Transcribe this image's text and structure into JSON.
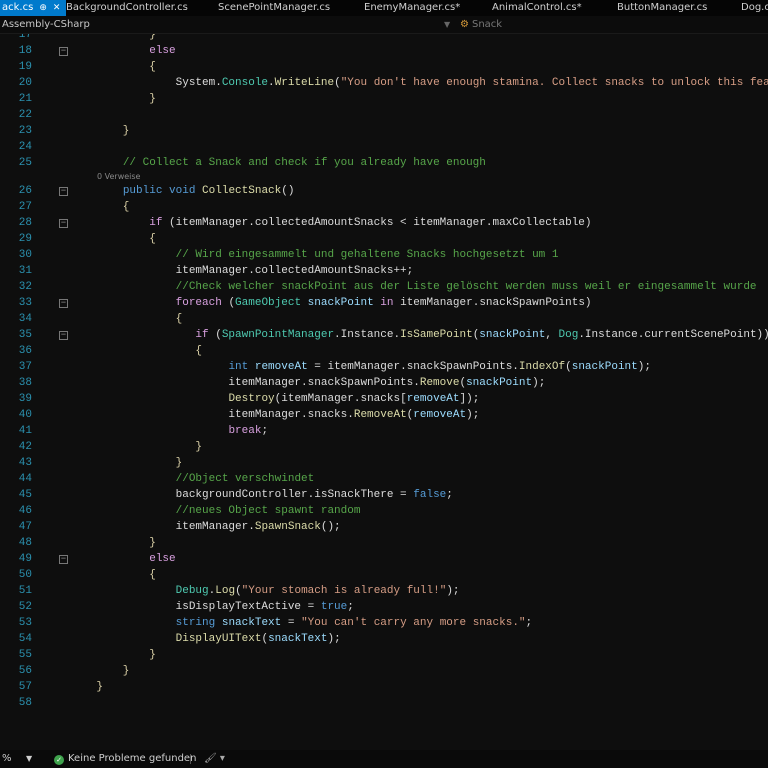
{
  "tabs": [
    {
      "label": "ack.cs",
      "active": true
    },
    {
      "label": "BackgroundController.cs"
    },
    {
      "label": "ScenePointManager.cs"
    },
    {
      "label": "EnemyManager.cs*"
    },
    {
      "label": "AnimalControl.cs*"
    },
    {
      "label": "ButtonManager.cs"
    },
    {
      "label": "Dog.c"
    }
  ],
  "navbar": {
    "project": "Assembly-CSharp",
    "member": "Snack",
    "member_icon": "class-member-icon"
  },
  "codelens": "0 Verweise",
  "lines": [
    {
      "n": "17",
      "t": [
        [
          "            }",
          "br"
        ]
      ]
    },
    {
      "n": "18",
      "fold": true,
      "t": [
        [
          "            ",
          ""
        ],
        [
          "else",
          "ctl"
        ]
      ]
    },
    {
      "n": "19",
      "t": [
        [
          "            {",
          "br"
        ]
      ]
    },
    {
      "n": "20",
      "t": [
        [
          "                System.",
          ""
        ],
        [
          "Console",
          "type"
        ],
        [
          ".",
          ""
        ],
        [
          "WriteLine",
          "method"
        ],
        [
          "(",
          ""
        ],
        [
          "\"You don't have enough stamina. Collect snacks to unlock this featu",
          "str"
        ]
      ]
    },
    {
      "n": "21",
      "t": [
        [
          "            }",
          "br"
        ]
      ]
    },
    {
      "n": "22",
      "t": []
    },
    {
      "n": "23",
      "t": [
        [
          "        }",
          "br"
        ]
      ]
    },
    {
      "n": "24",
      "t": []
    },
    {
      "n": "25",
      "t": [
        [
          "        ",
          ""
        ],
        [
          "// Collect a Snack and check if you already have enough",
          "cmt"
        ]
      ]
    },
    {
      "n": "26",
      "fold": true,
      "lens": true,
      "t": [
        [
          "        ",
          ""
        ],
        [
          "public",
          "kw"
        ],
        [
          " ",
          ""
        ],
        [
          "void",
          "kw"
        ],
        [
          " ",
          ""
        ],
        [
          "CollectSnack",
          "method"
        ],
        [
          "()",
          ""
        ]
      ]
    },
    {
      "n": "27",
      "t": [
        [
          "        {",
          "br"
        ]
      ]
    },
    {
      "n": "28",
      "fold": true,
      "t": [
        [
          "            ",
          ""
        ],
        [
          "if",
          "ctl"
        ],
        [
          " (itemManager.collectedAmountSnacks < itemManager.maxCollectable)",
          ""
        ]
      ]
    },
    {
      "n": "29",
      "t": [
        [
          "            {",
          "br"
        ]
      ]
    },
    {
      "n": "30",
      "t": [
        [
          "                ",
          ""
        ],
        [
          "// Wird eingesammelt und gehaltene Snacks hochgesetzt um 1",
          "cmt"
        ]
      ]
    },
    {
      "n": "31",
      "t": [
        [
          "                itemManager.collectedAmountSnacks++;",
          ""
        ]
      ]
    },
    {
      "n": "32",
      "t": [
        [
          "                ",
          ""
        ],
        [
          "//Check welcher snackPoint aus der Liste gelöscht werden muss weil er eingesammelt wurde",
          "cmt"
        ]
      ]
    },
    {
      "n": "33",
      "fold": true,
      "t": [
        [
          "                ",
          ""
        ],
        [
          "foreach",
          "ctl"
        ],
        [
          " (",
          ""
        ],
        [
          "GameObject",
          "type"
        ],
        [
          " ",
          ""
        ],
        [
          "snackPoint",
          "var"
        ],
        [
          " ",
          ""
        ],
        [
          "in",
          "ctl"
        ],
        [
          " itemManager.snackSpawnPoints)",
          ""
        ]
      ]
    },
    {
      "n": "34",
      "t": [
        [
          "                {",
          "br"
        ]
      ]
    },
    {
      "n": "35",
      "fold": true,
      "t": [
        [
          "                   ",
          ""
        ],
        [
          "if",
          "ctl"
        ],
        [
          " (",
          ""
        ],
        [
          "SpawnPointManager",
          "type"
        ],
        [
          ".Instance.",
          ""
        ],
        [
          "IsSamePoint",
          "method"
        ],
        [
          "(",
          ""
        ],
        [
          "snackPoint",
          "var"
        ],
        [
          ", ",
          ""
        ],
        [
          "Dog",
          "type"
        ],
        [
          ".Instance.currentScenePoint))",
          ""
        ]
      ]
    },
    {
      "n": "36",
      "t": [
        [
          "                   {",
          "br"
        ]
      ]
    },
    {
      "n": "37",
      "t": [
        [
          "                        ",
          ""
        ],
        [
          "int",
          "kw"
        ],
        [
          " ",
          ""
        ],
        [
          "removeAt",
          "var"
        ],
        [
          " = itemManager.snackSpawnPoints.",
          ""
        ],
        [
          "IndexOf",
          "method"
        ],
        [
          "(",
          ""
        ],
        [
          "snackPoint",
          "var"
        ],
        [
          ");",
          ""
        ]
      ]
    },
    {
      "n": "38",
      "t": [
        [
          "                        itemManager.snackSpawnPoints.",
          ""
        ],
        [
          "Remove",
          "method"
        ],
        [
          "(",
          ""
        ],
        [
          "snackPoint",
          "var"
        ],
        [
          ");",
          ""
        ]
      ]
    },
    {
      "n": "39",
      "t": [
        [
          "                        ",
          ""
        ],
        [
          "Destroy",
          "method"
        ],
        [
          "(itemManager.snacks[",
          ""
        ],
        [
          "removeAt",
          "var"
        ],
        [
          "]);",
          ""
        ]
      ]
    },
    {
      "n": "40",
      "t": [
        [
          "                        itemManager.snacks.",
          ""
        ],
        [
          "RemoveAt",
          "method"
        ],
        [
          "(",
          ""
        ],
        [
          "removeAt",
          "var"
        ],
        [
          ");",
          ""
        ]
      ]
    },
    {
      "n": "41",
      "t": [
        [
          "                        ",
          ""
        ],
        [
          "break",
          "ctl"
        ],
        [
          ";",
          ""
        ]
      ]
    },
    {
      "n": "42",
      "t": [
        [
          "                   }",
          "br"
        ]
      ]
    },
    {
      "n": "43",
      "t": [
        [
          "                }",
          "br"
        ]
      ]
    },
    {
      "n": "44",
      "t": [
        [
          "                ",
          ""
        ],
        [
          "//Object verschwindet",
          "cmt"
        ]
      ]
    },
    {
      "n": "45",
      "t": [
        [
          "                backgroundController.isSnackThere = ",
          ""
        ],
        [
          "false",
          "kw"
        ],
        [
          ";",
          ""
        ]
      ]
    },
    {
      "n": "46",
      "t": [
        [
          "                ",
          ""
        ],
        [
          "//neues Object spawnt random",
          "cmt"
        ]
      ]
    },
    {
      "n": "47",
      "t": [
        [
          "                itemManager.",
          ""
        ],
        [
          "SpawnSnack",
          "method"
        ],
        [
          "();",
          ""
        ]
      ]
    },
    {
      "n": "48",
      "t": [
        [
          "            }",
          "br"
        ]
      ]
    },
    {
      "n": "49",
      "fold": true,
      "t": [
        [
          "            ",
          ""
        ],
        [
          "else",
          "ctl"
        ]
      ]
    },
    {
      "n": "50",
      "t": [
        [
          "            {",
          "br"
        ]
      ]
    },
    {
      "n": "51",
      "t": [
        [
          "                ",
          ""
        ],
        [
          "Debug",
          "type"
        ],
        [
          ".",
          ""
        ],
        [
          "Log",
          "method"
        ],
        [
          "(",
          ""
        ],
        [
          "\"Your stomach is already full!\"",
          "str"
        ],
        [
          ");",
          ""
        ]
      ]
    },
    {
      "n": "52",
      "t": [
        [
          "                isDisplayTextActive = ",
          ""
        ],
        [
          "true",
          "kw"
        ],
        [
          ";",
          ""
        ]
      ]
    },
    {
      "n": "53",
      "t": [
        [
          "                ",
          ""
        ],
        [
          "string",
          "kw"
        ],
        [
          " ",
          ""
        ],
        [
          "snackText",
          "var"
        ],
        [
          " = ",
          ""
        ],
        [
          "\"You can't carry any more snacks.\"",
          "str"
        ],
        [
          ";",
          ""
        ]
      ]
    },
    {
      "n": "54",
      "t": [
        [
          "                ",
          ""
        ],
        [
          "DisplayUIText",
          "method"
        ],
        [
          "(",
          ""
        ],
        [
          "snackText",
          "var"
        ],
        [
          ");",
          ""
        ]
      ]
    },
    {
      "n": "55",
      "t": [
        [
          "            }",
          "br"
        ]
      ]
    },
    {
      "n": "56",
      "t": [
        [
          "        }",
          "br"
        ]
      ]
    },
    {
      "n": "57",
      "t": [
        [
          "    }",
          "br"
        ]
      ]
    },
    {
      "n": "58",
      "t": []
    }
  ],
  "status": {
    "zoom": "%",
    "problems": "Keine Probleme gefunden"
  }
}
